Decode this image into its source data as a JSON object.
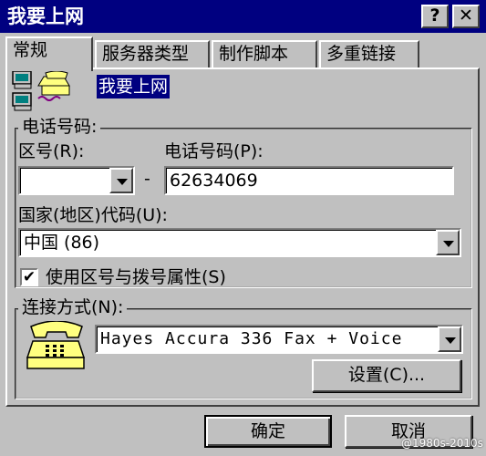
{
  "window": {
    "title": "我要上网",
    "help_label": "?",
    "close_label": "✕"
  },
  "tabs": [
    {
      "label": "常规"
    },
    {
      "label": "服务器类型"
    },
    {
      "label": "制作脚本"
    },
    {
      "label": "多重链接"
    }
  ],
  "general": {
    "connection_name": "我要上网",
    "phone_group_label": "电话号码:",
    "area_code_label": "区号(R):",
    "area_code_value": "",
    "dash": "-",
    "phone_label": "电话号码(P):",
    "phone_value": "62634069",
    "country_label": "国家(地区)代码(U):",
    "country_value": "中国 (86)",
    "use_area_label": "使用区号与拨号属性(S)",
    "use_area_checked": true,
    "connect_using_label": "连接方式(N):",
    "modem_value": "Hayes Accura 336 Fax + Voice",
    "configure_label": "设置(C)..."
  },
  "footer": {
    "ok_label": "确定",
    "cancel_label": "取消"
  },
  "watermark": "@1980s-2010s",
  "icons": {
    "connection": "dialup-computer-phone-icon",
    "modem": "telephone-icon",
    "checkmark": "checkmark-icon",
    "dropdown": "chevron-down-icon"
  }
}
